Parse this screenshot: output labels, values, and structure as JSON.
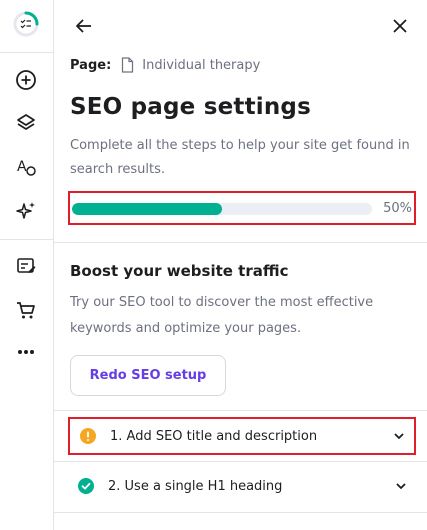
{
  "rail": {
    "icons": [
      "checklist-progress-icon",
      "add-icon",
      "layers-icon",
      "style-icon",
      "ai-sparkle-icon",
      "edit-list-icon",
      "cart-icon",
      "more-icon"
    ],
    "progress_color": "#00b090"
  },
  "topbar": {
    "back_icon": "arrow-left-icon",
    "close_icon": "close-icon"
  },
  "page": {
    "label": "Page:",
    "name": "Individual therapy"
  },
  "header": {
    "title": "SEO page settings",
    "description": "Complete all the steps to help your site get found in search results."
  },
  "progress": {
    "value": 0.5,
    "label": "50%",
    "color": "#00b090"
  },
  "boost": {
    "title": "Boost your website traffic",
    "description": "Try our SEO tool to discover the most effective keywords and optimize your pages.",
    "button_label": "Redo SEO setup",
    "button_color": "#673de6"
  },
  "steps": [
    {
      "label": "1. Add SEO title and description",
      "status": "warning",
      "status_color": "#f5a623"
    },
    {
      "label": "2. Use a single H1 heading",
      "status": "done",
      "status_color": "#00b090"
    }
  ]
}
